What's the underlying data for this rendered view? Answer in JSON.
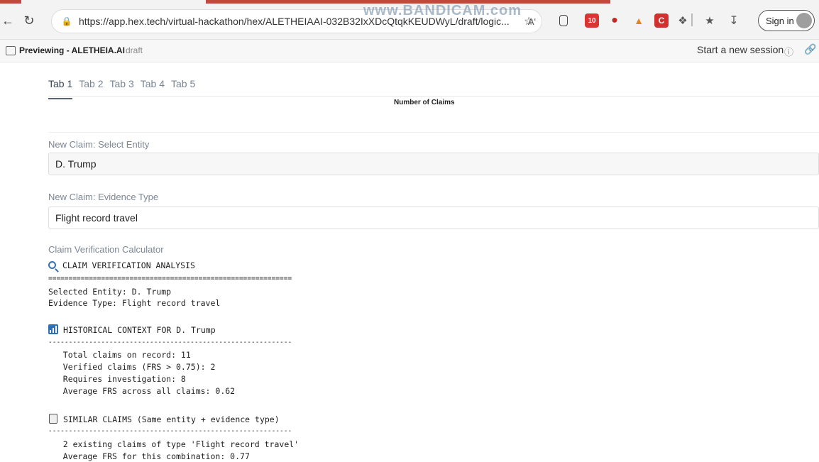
{
  "browser": {
    "url": "https://app.hex.tech/virtual-hackathon/hex/ALETHEIAAI-032B32IxXDcQtqkKEUDWyL/draft/logic...",
    "read_aloud": "Aʹ",
    "watermark": "www.BANDICAM.com",
    "sign_in": "Sign in",
    "ext_badge": "10"
  },
  "app": {
    "preview_title": "Previewing - ALETHEIA.AI",
    "draft": "draft",
    "session_label": "Start a new session"
  },
  "tabs": [
    "Tab 1",
    "Tab 2",
    "Tab 3",
    "Tab 4",
    "Tab 5"
  ],
  "chart": {
    "title": "Number of Claims"
  },
  "entity": {
    "label": "New Claim: Select Entity",
    "value": "D. Trump"
  },
  "evidence": {
    "label": "New Claim: Evidence Type",
    "value": "Flight record travel"
  },
  "calculator": {
    "label": "Claim Verification Calculator",
    "heading": "CLAIM VERIFICATION ANALYSIS",
    "double_rule": "============================================================",
    "entity_line": "Selected Entity: D. Trump",
    "evidence_line": "Evidence Type: Flight record travel",
    "history_heading": "HISTORICAL CONTEXT FOR D. Trump",
    "rule": "------------------------------------------------------------",
    "history_lines": [
      "   Total claims on record: 11",
      "   Verified claims (FRS > 0.75): 2",
      "   Requires investigation: 8",
      "   Average FRS across all claims: 0.62"
    ],
    "similar_heading": "SIMILAR CLAIMS (Same entity + evidence type)",
    "similar_lines": [
      "   2 existing claims of type 'Flight record travel'",
      "   Average FRS for this combination: 0.77"
    ]
  }
}
